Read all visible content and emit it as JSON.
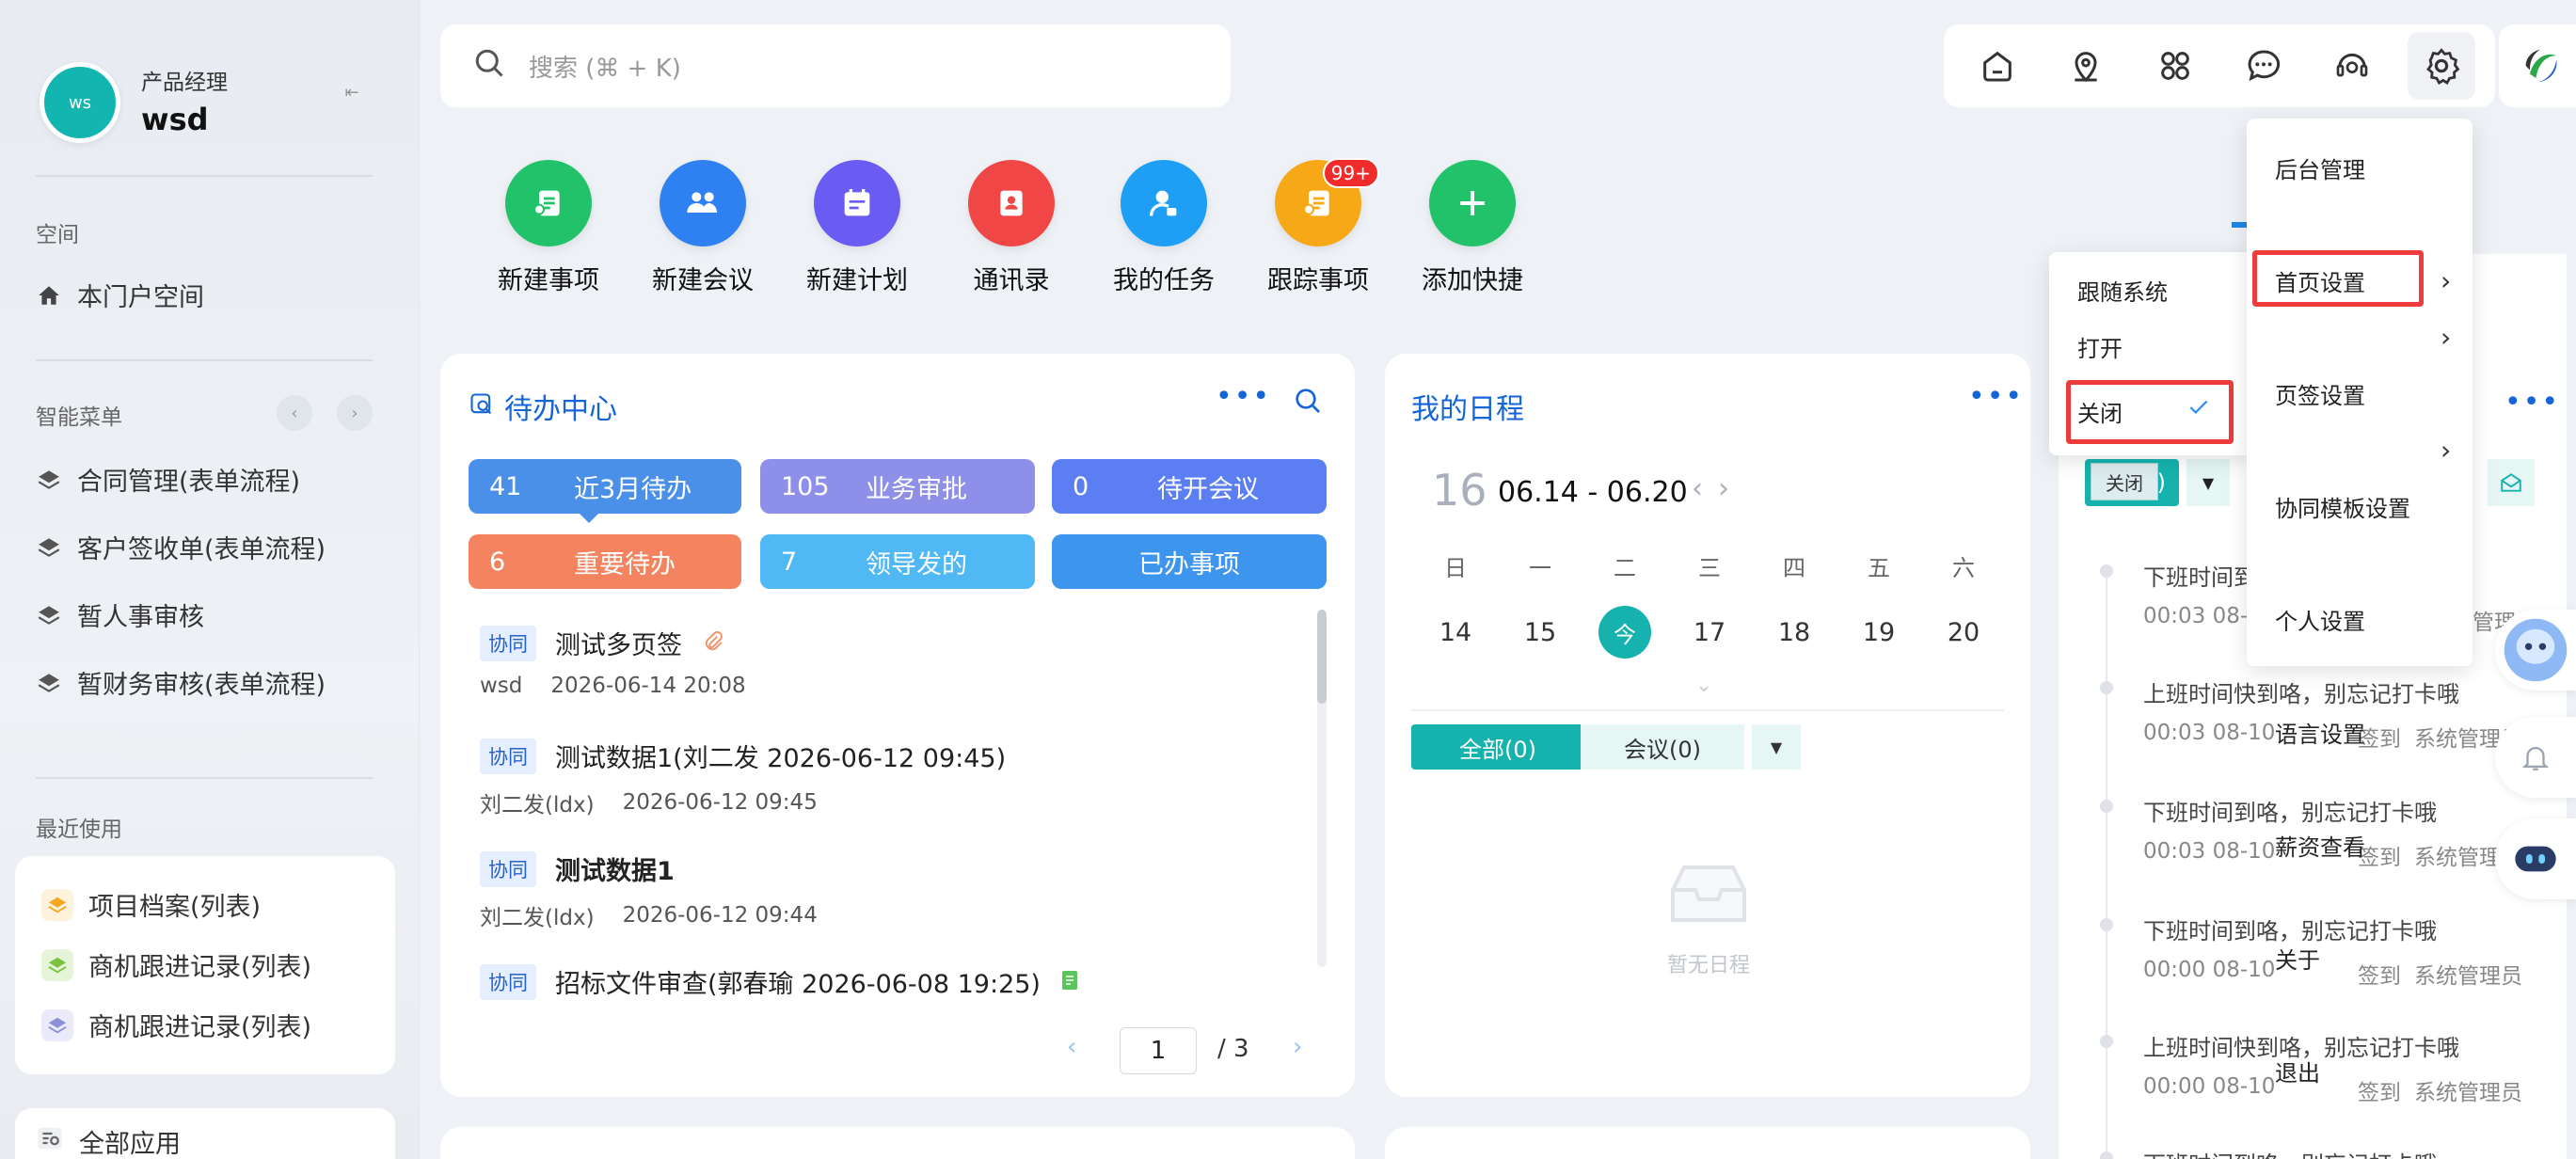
{
  "user": {
    "avatar_text": "ws",
    "role": "产品经理",
    "name": "wsd"
  },
  "sidebar": {
    "space_title": "空间",
    "space_item": "本门户空间",
    "smart_menu_title": "智能菜单",
    "smart_items": [
      "合同管理(表单流程)",
      "客户签收单(表单流程)",
      "暂人事审核",
      "暂财务审核(表单流程)"
    ],
    "recent_title": "最近使用",
    "recent_items": [
      {
        "label": "项目档案(列表)",
        "color": "#f5a623"
      },
      {
        "label": "商机跟进记录(列表)",
        "color": "#7cc242"
      },
      {
        "label": "商机跟进记录(列表)",
        "color": "#8a8fd8"
      }
    ],
    "all_apps": "全部应用"
  },
  "search": {
    "placeholder": "搜索 (⌘ + K)"
  },
  "toolbar": {
    "icons": [
      "home-icon",
      "location-icon",
      "apps-icon",
      "chat-icon",
      "support-icon",
      "gear-icon"
    ]
  },
  "shortcuts": [
    {
      "label": "新建事项",
      "color": "#21c26a"
    },
    {
      "label": "新建会议",
      "color": "#2f80f0"
    },
    {
      "label": "新建计划",
      "color": "#6a5cf2"
    },
    {
      "label": "通讯录",
      "color": "#f04646"
    },
    {
      "label": "我的任务",
      "color": "#1e9ff5"
    },
    {
      "label": "跟踪事项",
      "color": "#f7a817",
      "badge": "99+"
    },
    {
      "label": "添加快捷",
      "color": "#21c26a"
    }
  ],
  "todo": {
    "title": "待办中心",
    "stats": [
      {
        "num": "41",
        "label": "近3月待办",
        "color": "#4a90e8"
      },
      {
        "num": "105",
        "label": "业务审批",
        "color": "#8e8fe8"
      },
      {
        "num": "0",
        "label": "待开会议",
        "color": "#5b7ff2"
      },
      {
        "num": "6",
        "label": "重要待办",
        "color": "#f4845f"
      },
      {
        "num": "7",
        "label": "领导发的",
        "color": "#4fb8f5"
      },
      {
        "num": "",
        "label": "已办事项",
        "color": "#3d95ee"
      }
    ],
    "items": [
      {
        "tag": "协同",
        "title": "测试多页签",
        "sub_user": "wsd",
        "sub_time": "2026-06-14 20:08"
      },
      {
        "tag": "协同",
        "title": "测试数据1(刘二发 2026-06-12 09:45)",
        "sub_user": "刘二发(ldx)",
        "sub_time": "2026-06-12 09:45"
      },
      {
        "tag": "协同",
        "title": "测试数据1",
        "sub_user": "刘二发(ldx)",
        "sub_time": "2026-06-12 09:44"
      },
      {
        "tag": "协同",
        "title": "招标文件审查(郭春瑜 2026-06-08 19:25)"
      }
    ],
    "page_current": "1",
    "page_total": "/ 3"
  },
  "schedule": {
    "title": "我的日程",
    "day": "16",
    "range": "06.14 - 06.20",
    "weekdays": [
      "日",
      "一",
      "二",
      "三",
      "四",
      "五",
      "六"
    ],
    "dates": [
      "14",
      "15",
      "今",
      "17",
      "18",
      "19",
      "20"
    ],
    "filter_all": "全部(0)",
    "filter_meeting": "会议(0)",
    "empty_text": "暂无日程"
  },
  "timeline": {
    "filter_label": "0)",
    "tooltip": "关闭",
    "items": [
      {
        "title": "下班时间到",
        "time": "00:03 08-1",
        "action": "",
        "who": "管理员"
      },
      {
        "title": "上班时间快到咯，别忘记打卡哦",
        "time": "00:03 08-10",
        "action": "签到",
        "who": "系统管理员"
      },
      {
        "title": "下班时间到咯，别忘记打卡哦",
        "time": "00:03 08-10",
        "action": "签到",
        "who": "系统管理员"
      },
      {
        "title": "下班时间到咯，别忘记打卡哦",
        "time": "00:00 08-10",
        "action": "签到",
        "who": "系统管理员"
      },
      {
        "title": "上班时间快到咯，别忘记打卡哦",
        "time": "00:00 08-10",
        "action": "签到",
        "who": "系统管理员"
      },
      {
        "title": "下班时间到咯，别忘记打卡哦"
      }
    ]
  },
  "settings_menu": {
    "items": [
      "后台管理",
      "首页设置",
      "页签设置",
      "协同模板设置",
      "个人设置",
      "语言设置",
      "薪资查看",
      "关于",
      "退出"
    ]
  },
  "tab_submenu": {
    "items": [
      "跟随系统",
      "打开",
      "关闭"
    ],
    "selected": "关闭"
  }
}
